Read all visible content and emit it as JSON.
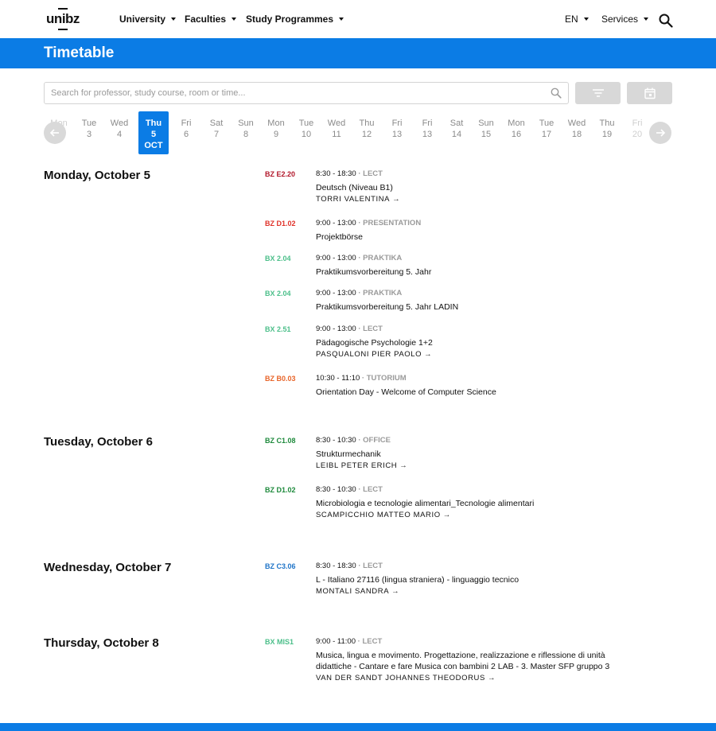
{
  "header": {
    "logo": "unibz",
    "nav": [
      "University",
      "Faculties",
      "Study Programmes"
    ],
    "language": "EN",
    "services": "Services"
  },
  "page_title": "Timetable",
  "search": {
    "placeholder": "Search for professor, study course, room or time..."
  },
  "date_strip": [
    {
      "day": "Mon",
      "num": ""
    },
    {
      "day": "Tue",
      "num": "3"
    },
    {
      "day": "Wed",
      "num": "4"
    },
    {
      "day": "Thu",
      "num": "5",
      "month": "OCT",
      "active": true
    },
    {
      "day": "Fri",
      "num": "6"
    },
    {
      "day": "Sat",
      "num": "7"
    },
    {
      "day": "Sun",
      "num": "8"
    },
    {
      "day": "Mon",
      "num": "9"
    },
    {
      "day": "Tue",
      "num": "10"
    },
    {
      "day": "Wed",
      "num": "11"
    },
    {
      "day": "Thu",
      "num": "12"
    },
    {
      "day": "Fri",
      "num": "13"
    },
    {
      "day": "Fri",
      "num": "13"
    },
    {
      "day": "Sat",
      "num": "14"
    },
    {
      "day": "Sun",
      "num": "15"
    },
    {
      "day": "Mon",
      "num": "16"
    },
    {
      "day": "Tue",
      "num": "17"
    },
    {
      "day": "Wed",
      "num": "18"
    },
    {
      "day": "Thu",
      "num": "19"
    },
    {
      "day": "Fri",
      "num": "20"
    }
  ],
  "days": [
    {
      "heading": "Monday, October 5",
      "events": [
        {
          "room": "BZ E2.20",
          "room_color": "#b2182b",
          "time": "8:30 - 18:30",
          "type": "LECT",
          "title": "Deutsch (Niveau B1)",
          "professor": "TORRI VALENTINA"
        },
        {
          "room": "BZ D1.02",
          "room_color": "#e0332a",
          "time": "9:00 - 13:00",
          "type": "PRESENTATION",
          "title": "Projektbörse",
          "professor": ""
        },
        {
          "room": "BX 2.04",
          "room_color": "#4cbf8a",
          "time": "9:00 - 13:00",
          "type": "PRAKTIKA",
          "title": "Praktikumsvorbereitung 5. Jahr",
          "professor": ""
        },
        {
          "room": "BX 2.04",
          "room_color": "#4cbf8a",
          "time": "9:00 - 13:00",
          "type": "PRAKTIKA",
          "title": "Praktikumsvorbereitung 5. Jahr LADIN",
          "professor": ""
        },
        {
          "room": "BX 2.51",
          "room_color": "#4cbf8a",
          "time": "9:00 - 13:00",
          "type": "LECT",
          "title": "Pädagogische Psychologie 1+2",
          "professor": "PASQUALONI PIER PAOLO"
        },
        {
          "room": "BZ B0.03",
          "room_color": "#e8652a",
          "time": "10:30 - 11:10",
          "type": "TUTORIUM",
          "title": "Orientation Day - Welcome of Computer Science",
          "professor": ""
        }
      ]
    },
    {
      "heading": "Tuesday, October 6",
      "events": [
        {
          "room": "BZ C1.08",
          "room_color": "#1e8a3c",
          "time": "8:30 - 10:30",
          "type": "OFFICE",
          "title": "Strukturmechanik",
          "professor": "LEIBL PETER ERICH"
        },
        {
          "room": "BZ D1.02",
          "room_color": "#1e8a3c",
          "time": "8:30 - 10:30",
          "type": "LECT",
          "title": "Microbiologia e tecnologie alimentari_Tecnologie alimentari",
          "professor": "SCAMPICCHIO MATTEO MARIO"
        }
      ]
    },
    {
      "heading": "Wednesday, October 7",
      "events": [
        {
          "room": "BZ C3.06",
          "room_color": "#1f74c8",
          "time": "8:30 - 18:30",
          "type": "LECT",
          "title": "L - Italiano 27116 (lingua straniera) - linguaggio tecnico",
          "professor": "MONTALI SANDRA"
        }
      ]
    },
    {
      "heading": "Thursday, October 8",
      "events": [
        {
          "room": "BX MIS1",
          "room_color": "#4cbf8a",
          "time": "9:00 - 11:00",
          "type": "LECT",
          "title": "Musica, lingua e movimento. Progettazione, realizzazione e riflessione di unità didattiche - Cantare e fare Musica con bambini 2 LAB - 3. Master SFP gruppo 3",
          "professor": "VAN DER SANDT JOHANNES THEODORUS"
        }
      ]
    }
  ],
  "colors": {
    "brand_blue": "#0b7ce5"
  }
}
